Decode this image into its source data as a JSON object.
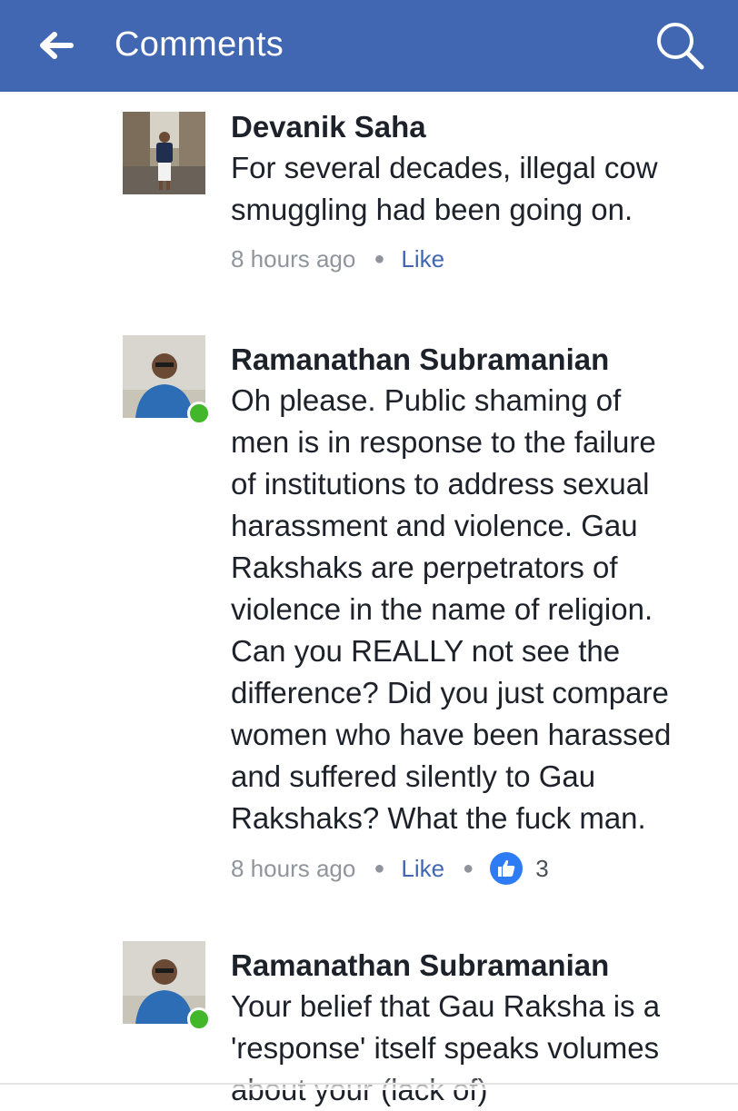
{
  "header": {
    "back_icon": "arrow-left-icon",
    "title": "Comments",
    "search_icon": "search-icon",
    "background": "#4267b2"
  },
  "comments": [
    {
      "author": "Devanik Saha",
      "text": "For several decades, illegal cow\nsmuggling had been going on.",
      "time": "8 hours ago",
      "like_label": "Like",
      "online": false
    },
    {
      "author": "Ramanathan Subramanian",
      "text": "Oh please. Public shaming of\nmen is in response to the failure\nof institutions to address sexual\nharassment and violence.  Gau\nRakshaks are perpetrators of\nviolence in the name of religion.\nCan you REALLY not see the\ndifference? Did you just compare\nwomen who have been harassed\nand suffered silently to Gau\nRakshaks? What the fuck man.",
      "time": "8 hours ago",
      "like_label": "Like",
      "reaction_icon": "thumbs-up-icon",
      "reaction_count": "3",
      "online": true
    },
    {
      "author": "Ramanathan Subramanian",
      "text": "Your belief that Gau Raksha is a\n'response' itself speaks volumes\nabout your (lack of)",
      "online": true
    }
  ],
  "colors": {
    "link": "#4267b2",
    "text": "#1d2129",
    "meta": "#90949c",
    "online": "#42b72a",
    "reaction": "#2e7bf6"
  }
}
